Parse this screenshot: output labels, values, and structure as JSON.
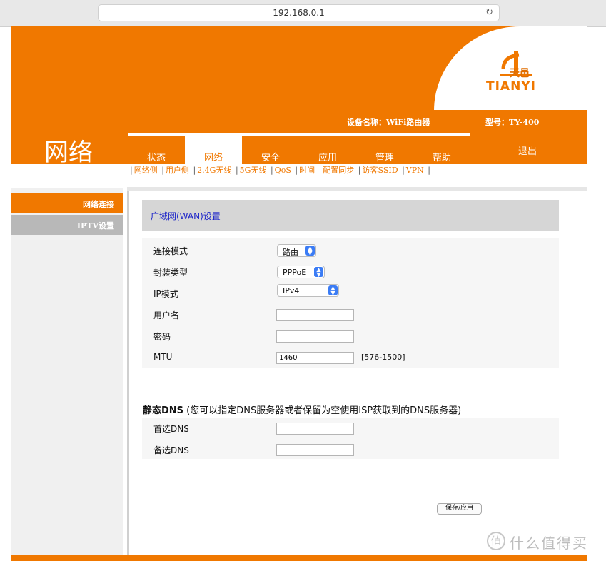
{
  "browser": {
    "url": "192.168.0.1",
    "reload_icon": "reload-icon"
  },
  "header": {
    "logo_cn": "天邑",
    "logo_en": "TIANYI",
    "section": "网络",
    "device_name": "设备名称：WiFi路由器",
    "model": "型号：TY-400",
    "logout": "退出"
  },
  "tabs": [
    {
      "label": "状态",
      "active": false
    },
    {
      "label": "网络",
      "active": true
    },
    {
      "label": "安全",
      "active": false
    },
    {
      "label": "应用",
      "active": false
    },
    {
      "label": "管理",
      "active": false
    },
    {
      "label": "帮助",
      "active": false
    }
  ],
  "subnav": [
    "网络侧",
    "用户侧",
    "2.4G无线",
    "5G无线",
    "QoS",
    "时间",
    "配置同步",
    "访客SSID",
    "VPN"
  ],
  "sidebar": {
    "items": [
      {
        "label": "网络连接"
      },
      {
        "label": "IPTV设置"
      }
    ]
  },
  "panel": {
    "title": "广域网(WAN)设置"
  },
  "form": {
    "mode_label": "连接模式",
    "mode_value": "路由",
    "encap_label": "封装类型",
    "encap_value": "PPPoE",
    "ipmode_label": "IP模式",
    "ipmode_value": "IPv4",
    "username_label": "用户名",
    "username_value": "",
    "password_label": "密码",
    "password_value": "",
    "mtu_label": "MTU",
    "mtu_value": "1460",
    "mtu_range": "[576-1500]"
  },
  "dns": {
    "title_bold": "静态DNS",
    "title_note": " (您可以指定DNS服务器或者保留为空使用ISP获取到的DNS服务器)",
    "primary_label": "首选DNS",
    "primary_value": "",
    "secondary_label": "备选DNS",
    "secondary_value": ""
  },
  "actions": {
    "save_label": "保存/应用"
  },
  "watermark": {
    "text": "什么值得买",
    "icon": "值"
  },
  "colors": {
    "accent": "#f07800",
    "title_blue": "#1a22c8"
  }
}
